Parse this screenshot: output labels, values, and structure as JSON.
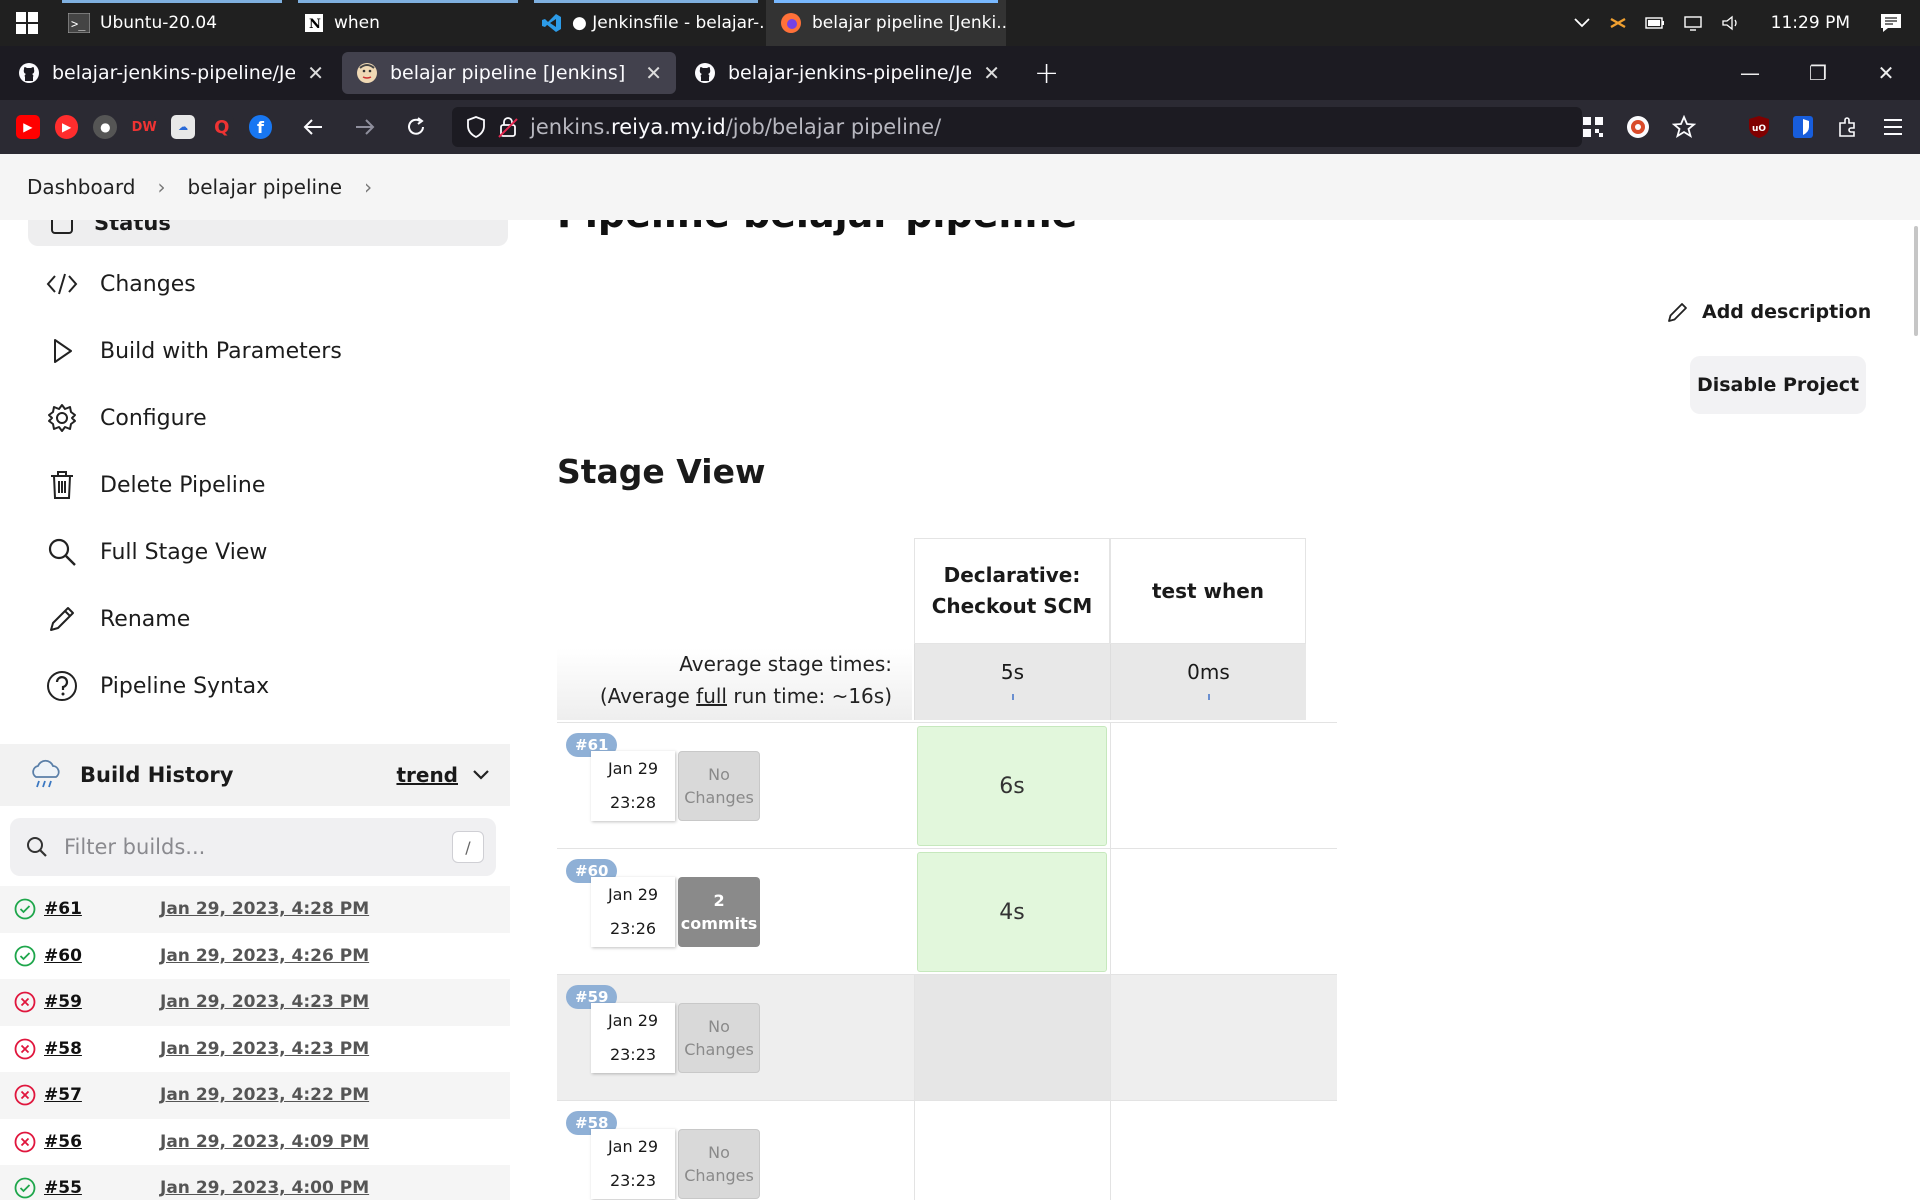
{
  "taskbar": {
    "apps": [
      {
        "label": "Ubuntu-20.04",
        "icon": "terminal-icon"
      },
      {
        "label": "when",
        "icon": "notion-icon"
      },
      {
        "label": "● Jenkinsfile - belajar-...",
        "icon": "vscode-icon"
      },
      {
        "label": "belajar pipeline [Jenki...",
        "icon": "firefox-icon"
      }
    ],
    "time": "11:29 PM"
  },
  "browser": {
    "tabs": [
      {
        "title": "belajar-jenkins-pipeline/Jenki",
        "icon": "github-icon"
      },
      {
        "title": "belajar pipeline [Jenkins]",
        "icon": "jenkins-icon"
      },
      {
        "title": "belajar-jenkins-pipeline/Jenki",
        "icon": "github-icon"
      }
    ],
    "url_host_prefix": "jenkins.",
    "url_host_main": "reiya.my.id",
    "url_path": "/job/belajar pipeline/"
  },
  "breadcrumb": {
    "items": [
      "Dashboard",
      "belajar pipeline"
    ]
  },
  "sidebar": {
    "status_label": "Status",
    "items": [
      {
        "label": "Changes",
        "icon": "code-icon"
      },
      {
        "label": "Build with Parameters",
        "icon": "play-icon"
      },
      {
        "label": "Configure",
        "icon": "gear-icon"
      },
      {
        "label": "Delete Pipeline",
        "icon": "trash-icon"
      },
      {
        "label": "Full Stage View",
        "icon": "search-icon"
      },
      {
        "label": "Rename",
        "icon": "pencil-icon"
      },
      {
        "label": "Pipeline Syntax",
        "icon": "help-icon"
      }
    ]
  },
  "build_history": {
    "title": "Build History",
    "trend_label": "trend",
    "filter_placeholder": "Filter builds...",
    "filter_shortcut": "/",
    "builds": [
      {
        "num": "#61",
        "date": "Jan 29, 2023, 4:28 PM",
        "status": "success"
      },
      {
        "num": "#60",
        "date": "Jan 29, 2023, 4:26 PM",
        "status": "success"
      },
      {
        "num": "#59",
        "date": "Jan 29, 2023, 4:23 PM",
        "status": "failed"
      },
      {
        "num": "#58",
        "date": "Jan 29, 2023, 4:23 PM",
        "status": "failed"
      },
      {
        "num": "#57",
        "date": "Jan 29, 2023, 4:22 PM",
        "status": "failed"
      },
      {
        "num": "#56",
        "date": "Jan 29, 2023, 4:09 PM",
        "status": "failed"
      },
      {
        "num": "#55",
        "date": "Jan 29, 2023, 4:00 PM",
        "status": "success"
      }
    ]
  },
  "main": {
    "title": "Pipeline belajar pipeline",
    "add_description": "Add description",
    "disable_project": "Disable Project",
    "stage_view_title": "Stage View"
  },
  "stage_view": {
    "stages": [
      "Declarative: Checkout SCM",
      "test when"
    ],
    "avg_label_line1": "Average stage times:",
    "avg_label_pre": "(Average ",
    "avg_label_full": "full",
    "avg_label_post": " run time: ~16s)",
    "avg_times": [
      "5s",
      "0ms"
    ],
    "runs": [
      {
        "badge": "#61",
        "date": "Jan 29",
        "time": "23:28",
        "changes": "No Changes",
        "changes_type": "none",
        "stage_times": [
          "6s",
          ""
        ],
        "failed": false
      },
      {
        "badge": "#60",
        "date": "Jan 29",
        "time": "23:26",
        "changes": "2 commits",
        "changes_type": "commits",
        "stage_times": [
          "4s",
          ""
        ],
        "failed": false
      },
      {
        "badge": "#59",
        "date": "Jan 29",
        "time": "23:23",
        "changes": "No Changes",
        "changes_type": "none",
        "stage_times": [
          "",
          ""
        ],
        "failed": true
      },
      {
        "badge": "#58",
        "date": "Jan 29",
        "time": "23:23",
        "changes": "No Changes",
        "changes_type": "none",
        "stage_times": [
          "",
          ""
        ],
        "failed": false
      }
    ]
  },
  "colors": {
    "success": "#1ea64b",
    "failed": "#e0163d",
    "stage_ok": "#e2f7dc",
    "badge": "#8fb0d6"
  }
}
